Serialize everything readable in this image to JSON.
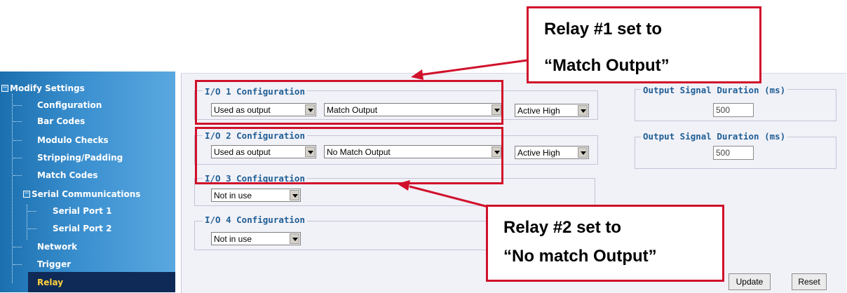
{
  "sidebar": {
    "items": [
      {
        "label": "Modify Settings"
      },
      {
        "label": "Configuration"
      },
      {
        "label": "Bar Codes"
      },
      {
        "label": "Modulo Checks"
      },
      {
        "label": "Stripping/Padding"
      },
      {
        "label": "Match Codes"
      },
      {
        "label": "Serial Communications"
      },
      {
        "label": "Serial Port 1"
      },
      {
        "label": "Serial Port 2"
      },
      {
        "label": "Network"
      },
      {
        "label": "Trigger"
      },
      {
        "label": "Relay"
      }
    ],
    "selected": "Relay",
    "colors": {
      "background": "#3a8fcf",
      "selected": "#0f2a57",
      "selected_text": "#ffd23a"
    }
  },
  "io": [
    {
      "legend": "I/O 1 Configuration",
      "usage": "Used as output",
      "mode": "Match Output",
      "polarity": "Active High"
    },
    {
      "legend": "I/O 2 Configuration",
      "usage": "Used as output",
      "mode": "No Match Output",
      "polarity": "Active High"
    },
    {
      "legend": "I/O 3 Configuration",
      "usage": "Not in use"
    },
    {
      "legend": "I/O 4 Configuration",
      "usage": "Not in use"
    }
  ],
  "output_duration": [
    {
      "legend": "Output Signal Duration (ms)",
      "value": "500"
    },
    {
      "legend": "Output Signal Duration (ms)",
      "value": "500"
    }
  ],
  "buttons": {
    "update": "Update",
    "reset": "Reset"
  },
  "callouts": {
    "relay1": {
      "line1": "Relay #1 set to",
      "line2": "“Match Output”"
    },
    "relay2": {
      "line1": "Relay #2 set to",
      "line2": "“No match Output”"
    }
  },
  "annotation_color": "#d0112b"
}
